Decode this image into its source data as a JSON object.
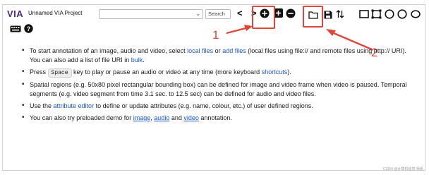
{
  "app": {
    "logo": "VIA",
    "project_name": "Unnamed VIA Project"
  },
  "toolbar": {
    "search_placeholder": "Search",
    "prev_label": "<",
    "next_label": ">"
  },
  "icons": {
    "add": "add-files-icon",
    "add_url": "add-url-icon",
    "remove": "remove-file-icon",
    "open": "open-project-icon",
    "save": "save-project-icon",
    "sort": "sort-icon",
    "rect": "rect-region-icon",
    "circle": "circle-region-icon",
    "ellipse": "ellipse-region-icon",
    "keyboard": "keyboard-icon",
    "help": "help-icon"
  },
  "annotations": {
    "one": "1",
    "two": "2",
    "color": "#e0453a"
  },
  "content": {
    "b1_a": "To start annotation of an image, audio and video, select ",
    "b1_link1": "local files",
    "b1_or": " or ",
    "b1_link2": "add files",
    "b1_b": " (local files using file:// and remote files using http:// URI). You can also add a list of file URI in ",
    "b1_link3": "bulk",
    "b1_end": ".",
    "b2_a": "Press ",
    "b2_key": "Space",
    "b2_b": " key to play or pause an audio or video at any time (more keyboard ",
    "b2_link": "shortcuts",
    "b2_end": ").",
    "b3": "Spatial regions (e.g. 50x80 pixel rectangular bounding box) can be defined for image and video frame when video is paused. Temporal segments (e.g. video segment from time 3.1 sec. to 12.5 sec) can be defined for audio and video files.",
    "b4_a": "Use the ",
    "b4_link": "attribute editor",
    "b4_b": " to define or update attributes (e.g. name, colour, etc.) of user defined regions.",
    "b5_a": "You can also try preloaded demo for ",
    "b5_link1": "image",
    "b5_comma": ", ",
    "b5_link2": "audio",
    "b5_and": " and ",
    "b5_link3": "video",
    "b5_end": " annotation."
  },
  "watermark": "CSDN @计算机视觉-杨帆"
}
